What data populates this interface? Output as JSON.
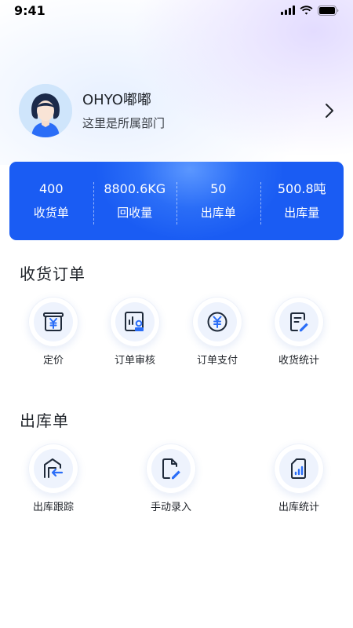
{
  "status_bar": {
    "time": "9:41"
  },
  "profile": {
    "name": "OHYO嘟嘟",
    "department": "这里是所属部门"
  },
  "stats": [
    {
      "value": "400",
      "label": "收货单"
    },
    {
      "value": "8800.6KG",
      "label": "回收量"
    },
    {
      "value": "50",
      "label": "出库单"
    },
    {
      "value": "500.8吨",
      "label": "出库量"
    }
  ],
  "sections": {
    "receiving": {
      "title": "收货订单",
      "items": [
        {
          "label": "定价",
          "icon": "pricing-icon"
        },
        {
          "label": "订单审核",
          "icon": "order-review-icon"
        },
        {
          "label": "订单支付",
          "icon": "order-payment-icon"
        },
        {
          "label": "收货统计",
          "icon": "receiving-statistics-icon"
        }
      ]
    },
    "outbound": {
      "title": "出库单",
      "items": [
        {
          "label": "出库跟踪",
          "icon": "outbound-tracking-icon"
        },
        {
          "label": "手动录入",
          "icon": "manual-entry-icon"
        },
        {
          "label": "出库统计",
          "icon": "outbound-statistics-icon"
        }
      ]
    }
  },
  "colors": {
    "accent": "#1a5cf3",
    "icon_dark": "#1f2a3a",
    "icon_blue": "#2a6df7"
  }
}
